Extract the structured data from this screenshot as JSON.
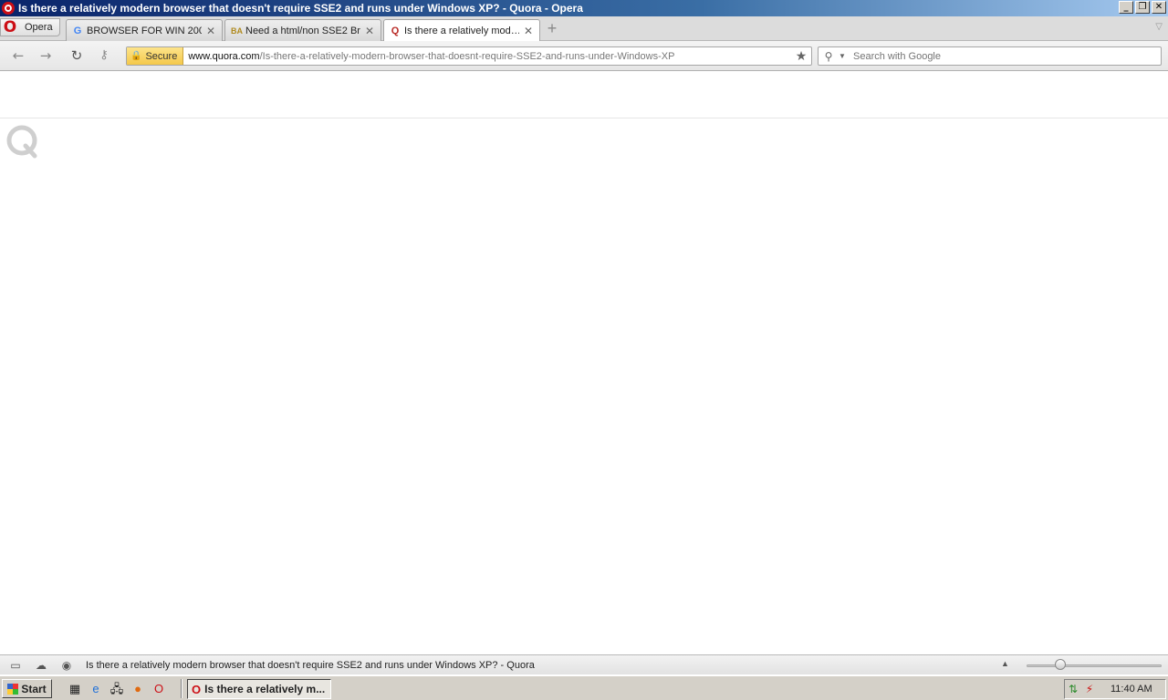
{
  "window": {
    "title": "Is there a relatively modern browser that doesn't require SSE2 and runs under Windows XP? - Quora - Opera"
  },
  "opera_menu": {
    "label": "Opera"
  },
  "tabs": [
    {
      "title": "BROWSER FOR WIN 200…",
      "favicon": "google-icon"
    },
    {
      "title": "Need a html/non SSE2 Br…",
      "favicon": "site-icon"
    },
    {
      "title": "Is there a relatively mod…",
      "favicon": "quora-icon",
      "active": true
    }
  ],
  "address_bar": {
    "security_label": "Secure",
    "url_host": "www.quora.com",
    "url_path": "/Is-there-a-relatively-modern-browser-that-doesnt-require-SSE2-and-runs-under-Windows-XP"
  },
  "search": {
    "placeholder": "Search with Google"
  },
  "status_bar": {
    "text": "Is there a relatively modern browser that doesn't require SSE2 and runs under Windows XP? - Quora",
    "zoom_level": 0.25
  },
  "taskbar": {
    "start_label": "Start",
    "task_title": "Is there a relatively m...",
    "clock": "11:40 AM"
  }
}
